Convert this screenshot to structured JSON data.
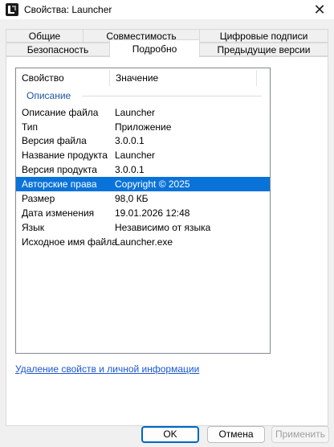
{
  "window": {
    "title": "Свойства: Launcher",
    "close_glyph": "✕"
  },
  "tabs_top": [
    "Общие",
    "Совместимость",
    "Цифровые подписи"
  ],
  "tabs_bottom": [
    "Безопасность",
    "Подробно",
    "Предыдущие версии"
  ],
  "active_tab": "Подробно",
  "list": {
    "headers": {
      "property": "Свойство",
      "value": "Значение"
    },
    "group": "Описание",
    "rows": [
      {
        "property": "Описание файла",
        "value": "Launcher"
      },
      {
        "property": "Тип",
        "value": "Приложение"
      },
      {
        "property": "Версия файла",
        "value": "3.0.0.1"
      },
      {
        "property": "Название продукта",
        "value": "Launcher"
      },
      {
        "property": "Версия продукта",
        "value": "3.0.0.1"
      },
      {
        "property": "Авторские права",
        "value": "Copyright © 2025",
        "selected": true
      },
      {
        "property": "Размер",
        "value": "98,0 КБ"
      },
      {
        "property": "Дата изменения",
        "value": "19.01.2026 12:48"
      },
      {
        "property": "Язык",
        "value": "Независимо от языка"
      },
      {
        "property": "Исходное имя файла",
        "value": "Launcher.exe"
      }
    ]
  },
  "remove_link": "Удаление свойств и личной информации",
  "buttons": {
    "ok": "OK",
    "cancel": "Отмена",
    "apply": "Применить"
  },
  "colors": {
    "selection": "#0a73d9",
    "group_header": "#1e54a4",
    "link": "#1a56d1",
    "default_button_border": "#0067c0"
  },
  "icons": {
    "app": "launcher-app-icon",
    "close": "close-icon"
  }
}
